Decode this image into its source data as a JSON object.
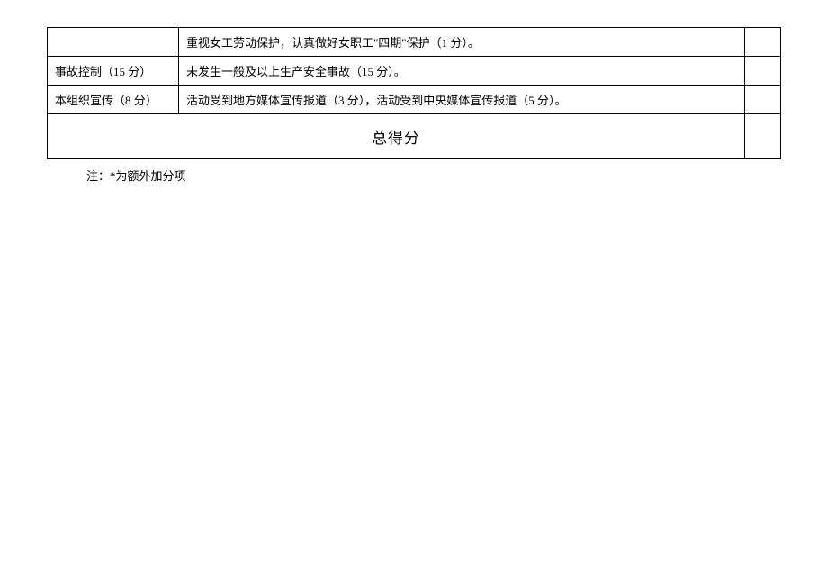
{
  "rows": [
    {
      "label": "",
      "content": "重视女工劳动保护，认真做好女职工\"四期\"保护（1 分）。",
      "score": ""
    },
    {
      "label": "事故控制（15 分）",
      "content": "未发生一般及以上生产安全事故（15 分）。",
      "score": ""
    },
    {
      "label": "本组织宣传（8 分）",
      "content": "活动受到地方媒体宣传报道（3 分），活动受到中央媒体宣传报道（5 分）。",
      "score": ""
    }
  ],
  "total_label": "总得分",
  "note": "注：*为额外加分项"
}
